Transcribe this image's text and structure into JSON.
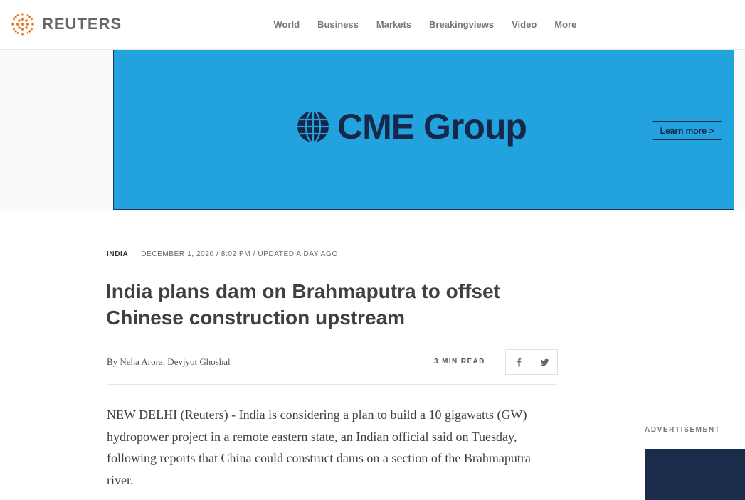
{
  "header": {
    "brand": "REUTERS",
    "brand_color": "#e87722",
    "nav": [
      "World",
      "Business",
      "Markets",
      "Breakingviews",
      "Video",
      "More"
    ]
  },
  "ad_banner": {
    "brand": "CME Group",
    "cta": "Learn more >",
    "background": "#23a3dd",
    "text_color": "#16274a"
  },
  "article": {
    "section": "INDIA",
    "dateline": "DECEMBER 1, 2020 / 8:02 PM / UPDATED A DAY AGO",
    "headline": "India plans dam on Brahmaputra to offset Chinese construction upstream",
    "byline_prefix": "By",
    "authors": "Neha Arora, Devjyot Ghoshal",
    "read_time": "3 MIN READ",
    "share_icons": [
      "facebook-icon",
      "twitter-icon"
    ],
    "body": "NEW DELHI (Reuters) - India is considering a plan to build a 10 gigawatts (GW) hydropower project in a remote eastern state, an Indian official said on Tuesday, following reports that China could construct dams on a section of the Brahmaputra river."
  },
  "sidebar": {
    "ad_label": "ADVERTISEMENT",
    "ad_color": "#1a2b4c"
  }
}
